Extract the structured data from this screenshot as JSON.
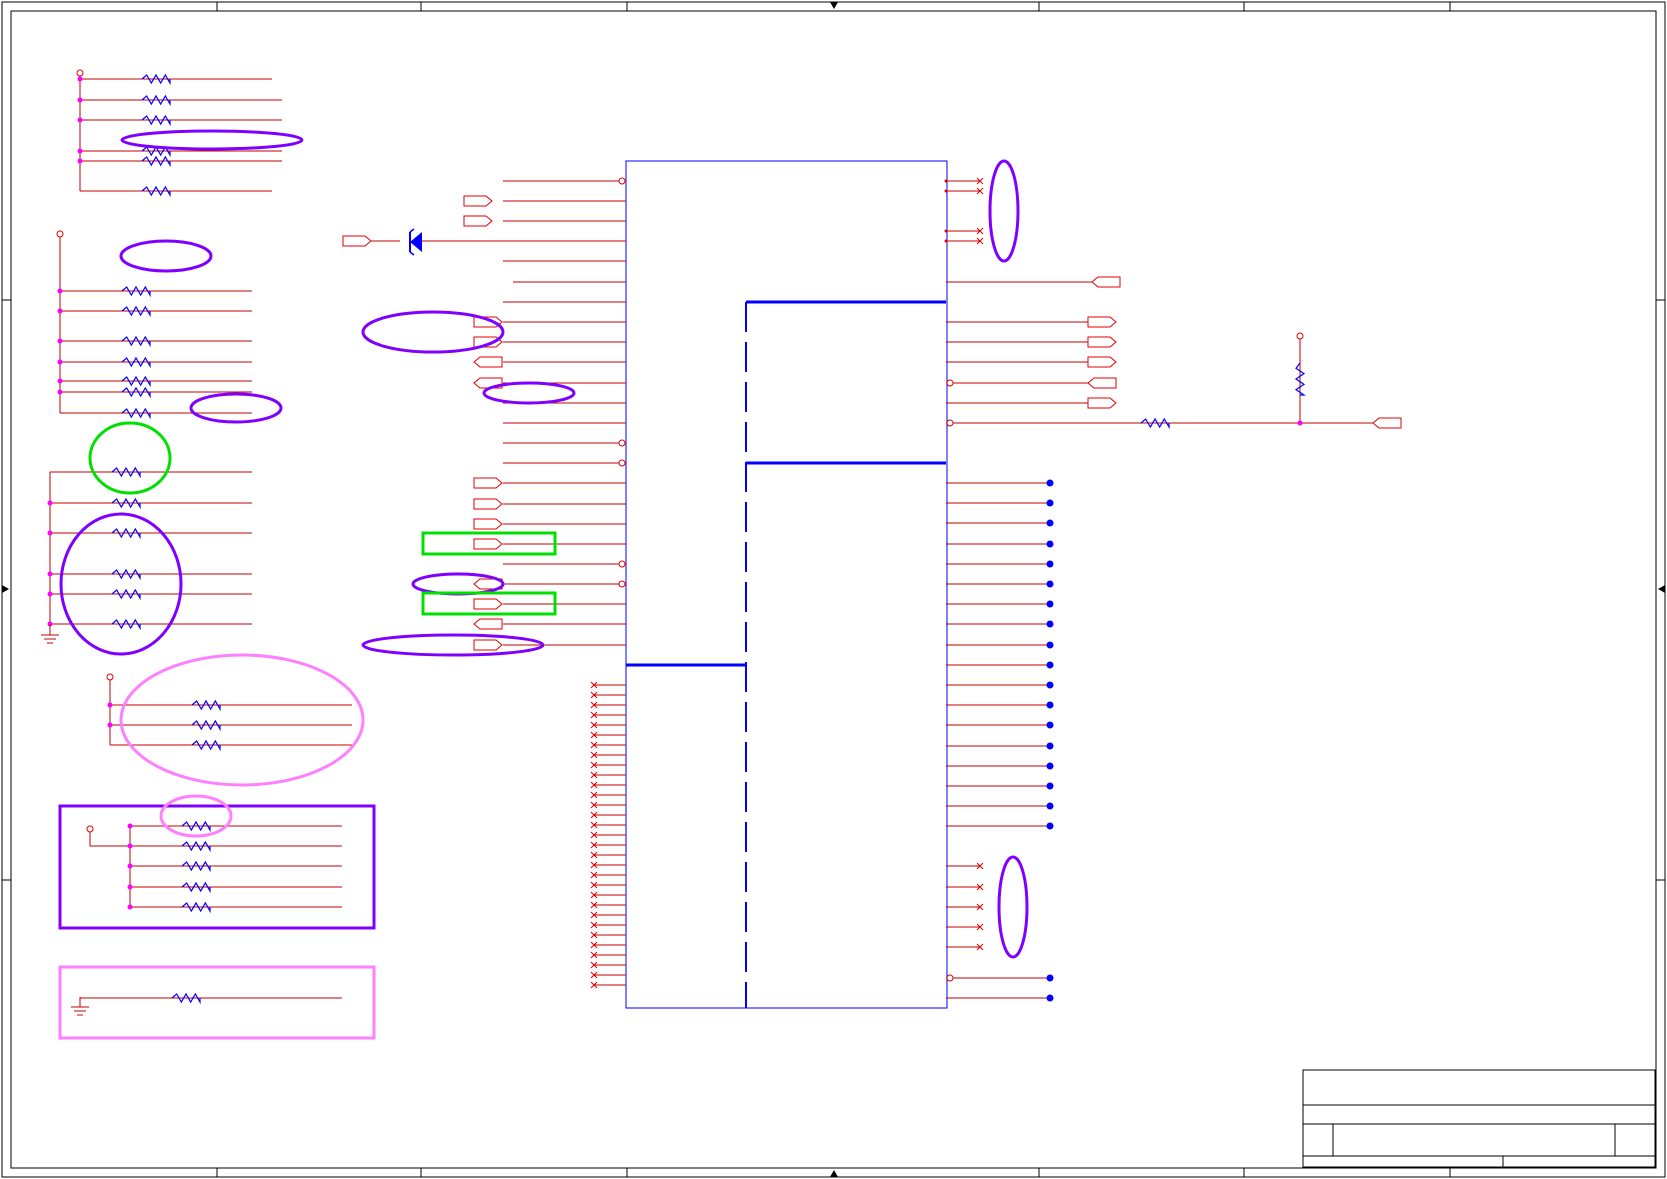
{
  "diagram": {
    "type": "schematic",
    "annotation_colors": {
      "wire": "#c00000",
      "component": "#0000ff",
      "junction": "#ff00ff",
      "highlight_purple": "#8000ff",
      "highlight_green": "#00e000",
      "highlight_pink": "#ff80ff"
    },
    "icons": [
      "resistor-icon",
      "diode-icon",
      "ground-icon",
      "port-flag-icon",
      "junction-dot-icon",
      "no-connect-icon"
    ]
  }
}
